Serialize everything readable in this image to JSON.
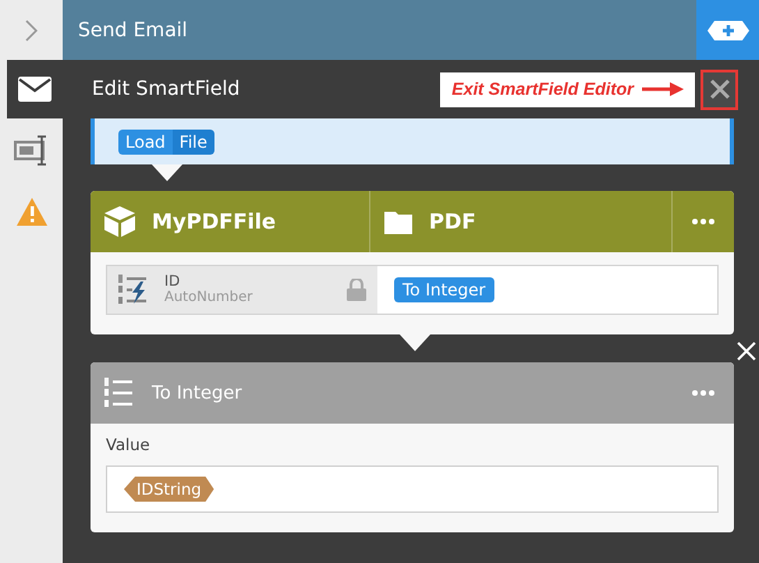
{
  "header": {
    "title": "Send Email"
  },
  "editor": {
    "title": "Edit SmartField",
    "annotation": "Exit SmartField Editor"
  },
  "sidebar": {
    "items": [
      {
        "kind": "mail",
        "selected": true
      },
      {
        "kind": "field",
        "selected": false
      },
      {
        "kind": "warning",
        "selected": false
      }
    ]
  },
  "source_field": {
    "tokens": [
      "Load",
      "File"
    ]
  },
  "object_card": {
    "name": "MyPDFFile",
    "type": "PDF",
    "field": {
      "name": "ID",
      "type": "AutoNumber",
      "locked": true
    },
    "mapping": "To Integer"
  },
  "function_card": {
    "title": "To Integer",
    "input_label": "Value",
    "input_token": "IDString"
  }
}
